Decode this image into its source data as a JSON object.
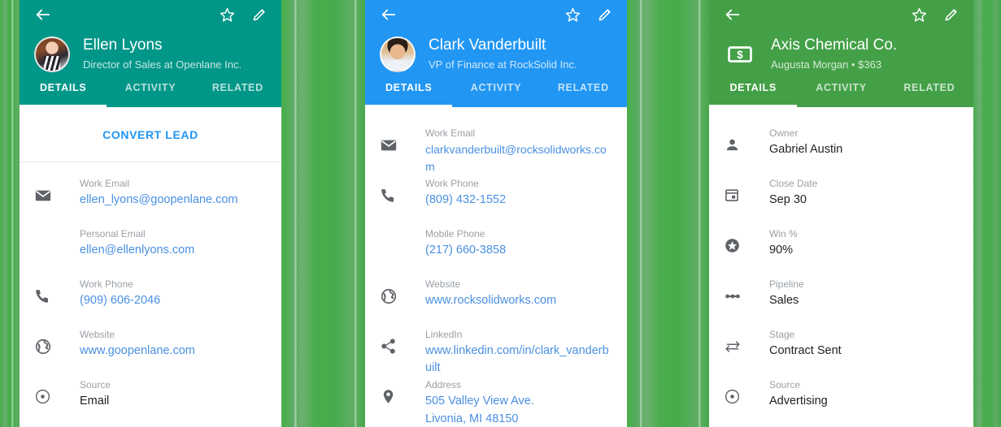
{
  "background": {
    "color": "#4caf4f"
  },
  "panels": [
    {
      "id": "lead-ellen-lyons",
      "accent": "#009688",
      "appbar": {
        "back_icon": "arrow-left-icon",
        "star_icon": "star-outline-icon",
        "edit_icon": "pencil-icon"
      },
      "identity": {
        "avatar": "avatar-ellen-lyons",
        "name": "Ellen Lyons",
        "subtitle": "Director of Sales at Openlane Inc."
      },
      "tabs": [
        {
          "label": "DETAILS",
          "active": true
        },
        {
          "label": "ACTIVITY",
          "active": false
        },
        {
          "label": "RELATED",
          "active": false
        }
      ],
      "action": {
        "label": "CONVERT LEAD"
      },
      "fields": [
        {
          "icon": "envelope-icon",
          "label": "Work Email",
          "value": "ellen_lyons@goopenlane.com",
          "link": true
        },
        {
          "icon": "none",
          "label": "Personal Email",
          "value": "ellen@ellenlyons.com",
          "link": true
        },
        {
          "icon": "phone-icon",
          "label": "Work Phone",
          "value": "(909) 606-2046",
          "link": true
        },
        {
          "icon": "globe-icon",
          "label": "Website",
          "value": "www.goopenlane.com",
          "link": true
        },
        {
          "icon": "source-icon",
          "label": "Source",
          "value": "Email",
          "link": false
        }
      ]
    },
    {
      "id": "contact-clark-vanderbuilt",
      "accent": "#2196f3",
      "appbar": {
        "back_icon": "arrow-left-icon",
        "star_icon": "star-outline-icon",
        "edit_icon": "pencil-icon"
      },
      "identity": {
        "avatar": "avatar-clark-vanderbuilt",
        "name": "Clark Vanderbuilt",
        "subtitle": "VP of Finance at RockSolid Inc."
      },
      "tabs": [
        {
          "label": "DETAILS",
          "active": true
        },
        {
          "label": "ACTIVITY",
          "active": false
        },
        {
          "label": "RELATED",
          "active": false
        }
      ],
      "action": null,
      "fields": [
        {
          "icon": "envelope-icon",
          "label": "Work Email",
          "value": "clarkvanderbuilt@rocksolidworks.com",
          "link": true
        },
        {
          "icon": "phone-icon",
          "label": "Work Phone",
          "value": "(809) 432-1552",
          "link": true
        },
        {
          "icon": "none",
          "label": "Mobile Phone",
          "value": "(217) 660-3858",
          "link": true
        },
        {
          "icon": "globe-icon",
          "label": "Website",
          "value": "www.rocksolidworks.com",
          "link": true
        },
        {
          "icon": "share-icon",
          "label": "LinkedIn",
          "value": "www.linkedin.com/in/clark_vanderbuilt",
          "link": true
        },
        {
          "icon": "pin-icon",
          "label": "Address",
          "value": "505 Valley View Ave.",
          "value2": "Livonia, MI 48150",
          "link": true
        }
      ]
    },
    {
      "id": "opportunity-axis-chemical",
      "accent": "#43a047",
      "appbar": {
        "back_icon": "arrow-left-icon",
        "star_icon": "star-outline-icon",
        "edit_icon": "pencil-icon"
      },
      "identity": {
        "avatar": "money-bill-icon",
        "name": "Axis Chemical Co.",
        "subtitle": "Augusta Morgan • $363"
      },
      "tabs": [
        {
          "label": "DETAILS",
          "active": true
        },
        {
          "label": "ACTIVITY",
          "active": false
        },
        {
          "label": "RELATED",
          "active": false
        }
      ],
      "action": null,
      "fields": [
        {
          "icon": "person-icon",
          "label": "Owner",
          "value": "Gabriel Austin",
          "link": false
        },
        {
          "icon": "calendar-icon",
          "label": "Close Date",
          "value": "Sep 30",
          "link": false
        },
        {
          "icon": "star-filled-icon",
          "label": "Win %",
          "value": "90%",
          "link": false
        },
        {
          "icon": "pipeline-icon",
          "label": "Pipeline",
          "value": "Sales",
          "link": false
        },
        {
          "icon": "stage-icon",
          "label": "Stage",
          "value": "Contract Sent",
          "link": false
        },
        {
          "icon": "source-icon",
          "label": "Source",
          "value": "Advertising",
          "link": false
        }
      ]
    }
  ]
}
